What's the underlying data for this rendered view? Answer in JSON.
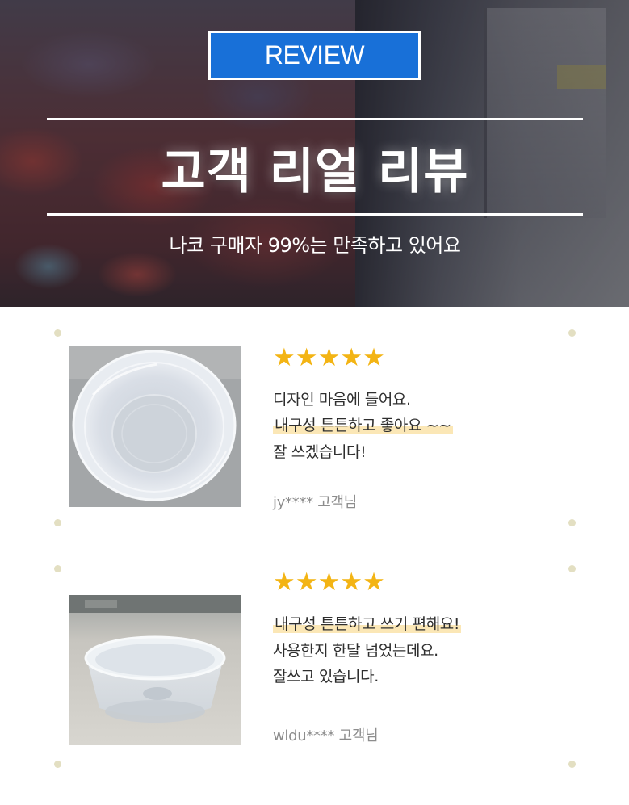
{
  "hero": {
    "badge": "REVIEW",
    "title": "고객 리얼 리뷰",
    "subtitle": "나코 구매자 99%는 만족하고 있어요"
  },
  "reviews": [
    {
      "stars": 5,
      "star_glyph": "★★★★★",
      "lines": [
        "디자인 마음에 들어요.",
        "내구성 튼튼하고 좋아요 ~~",
        "잘 쓰겠습니다!"
      ],
      "highlighted_line": 2,
      "reviewer": "jy**** 고객님"
    },
    {
      "stars": 5,
      "star_glyph": "★★★★★",
      "lines": [
        "내구성 튼튼하고 쓰기 편해요!",
        "사용한지 한달 넘었는데요.",
        "잘쓰고 있습니다."
      ],
      "highlighted_line": 1,
      "reviewer": "wldu**** 고객님"
    }
  ],
  "colors": {
    "badge_blue": "#1870d8",
    "star_gold": "#f3b414",
    "highlight": "#fbe7b6",
    "dot": "#e3dfc2"
  }
}
